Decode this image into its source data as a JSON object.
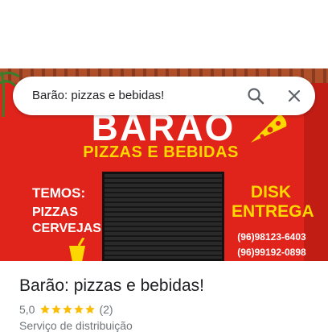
{
  "search": {
    "query": "Barão: pizzas e bebidas!"
  },
  "photo": {
    "sign_brand": "BARÃO",
    "sign_subtitle": "PIZZAS E BEBIDAS",
    "sign_temos": "TEMOS:",
    "sign_items": [
      "PIZZAS",
      "CERVEJAS"
    ],
    "sign_disk": [
      "DISK",
      "ENTREGA"
    ],
    "sign_phones": [
      "(96)98123-6403",
      "(96)99192-0898"
    ]
  },
  "place": {
    "title": "Barão: pizzas e bebidas!",
    "rating": "5,0",
    "stars": 5,
    "review_count": "(2)",
    "category": "Serviço de distribuição"
  },
  "colors": {
    "facade": "#e0241b",
    "sign_yellow": "#fdd800",
    "star": "#fbbc04",
    "text_primary": "#202124",
    "text_secondary": "#70757a"
  },
  "icons": [
    "search-icon",
    "close-icon",
    "star-icon",
    "pizza-slice-icon",
    "drink-icon",
    "palm-tree-icon"
  ]
}
